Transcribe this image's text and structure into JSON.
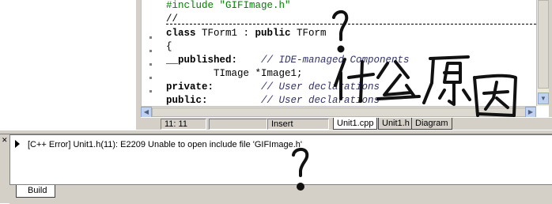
{
  "editor": {
    "lines": [
      {
        "parts": [
          {
            "t": "#include \"GIFImage.h\"",
            "c": "inc"
          }
        ]
      },
      {
        "parts": [
          {
            "t": "//",
            "c": ""
          }
        ]
      },
      {
        "parts": [
          {
            "t": "class",
            "c": "kw"
          },
          {
            "t": " TForm1 : ",
            "c": ""
          },
          {
            "t": "public",
            "c": "kw"
          },
          {
            "t": " TForm",
            "c": ""
          }
        ]
      },
      {
        "parts": [
          {
            "t": "{",
            "c": ""
          }
        ]
      },
      {
        "parts": [
          {
            "t": "__published:",
            "c": "kw"
          },
          {
            "t": "    ",
            "c": ""
          },
          {
            "t": "// IDE-managed Components",
            "c": "cm"
          }
        ]
      },
      {
        "parts": [
          {
            "t": "        TImage *Image1;",
            "c": ""
          }
        ]
      },
      {
        "parts": [
          {
            "t": "private:",
            "c": "kw"
          },
          {
            "t": "        ",
            "c": ""
          },
          {
            "t": "// User declarations",
            "c": "cm"
          }
        ]
      },
      {
        "parts": [
          {
            "t": "public:",
            "c": "kw"
          },
          {
            "t": "         ",
            "c": ""
          },
          {
            "t": "// User declarations",
            "c": "cm"
          }
        ]
      }
    ]
  },
  "status": {
    "position": "11: 11",
    "modified": "",
    "mode": "Insert"
  },
  "tabs": {
    "unit_cpp": "Unit1.cpp",
    "unit_h": "Unit1.h",
    "diagram": "Diagram"
  },
  "messages": {
    "error": "[C++ Error] Unit1.h(11): E2209 Unable to open include file 'GIFImage.h'"
  },
  "bottom_tab": {
    "build": "Build"
  },
  "annotations": {
    "handwriting_chinese": "什么原因",
    "question_mark": "?"
  },
  "colors": {
    "include": "#008000",
    "comment": "#333366",
    "panel": "#d4d0c8",
    "scroll_button": "#c1d2ee"
  }
}
